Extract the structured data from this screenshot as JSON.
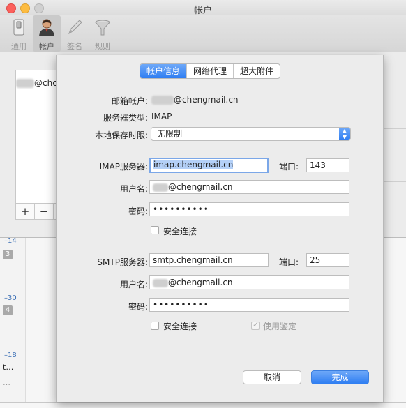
{
  "window": {
    "title": "帐户"
  },
  "toolbar": {
    "items": [
      {
        "label": "通用",
        "icon": "switch-icon",
        "active": false
      },
      {
        "label": "帐户",
        "icon": "user-icon",
        "active": true
      },
      {
        "label": "签名",
        "icon": "pen-icon",
        "active": false
      },
      {
        "label": "规则",
        "icon": "funnel-icon",
        "active": false
      }
    ]
  },
  "accounts": {
    "first_suffix": "@chc",
    "add": "+",
    "remove": "−"
  },
  "background": {
    "nums": [
      "–14",
      "–30",
      "–18"
    ],
    "badges": [
      "3",
      "4"
    ],
    "snippets": [
      "t…",
      "…"
    ]
  },
  "sheet": {
    "tabs": [
      {
        "label": "帐户信息",
        "active": true
      },
      {
        "label": "网络代理",
        "active": false
      },
      {
        "label": "超大附件",
        "active": false
      }
    ],
    "info": {
      "email_label": "邮箱帐户:",
      "email_value": "@chengmail.cn",
      "server_type_label": "服务器类型:",
      "server_type_value": "IMAP",
      "retention_label": "本地保存时限:",
      "retention_value": "无限制"
    },
    "imap": {
      "server_label": "IMAP服务器:",
      "server_value": "imap.chengmail.cn",
      "port_label": "端口:",
      "port_value": "143",
      "user_label": "用户名:",
      "user_value": "@chengmail.cn",
      "pass_label": "密码:",
      "pass_value": "••••••••••",
      "secure_label": "安全连接"
    },
    "smtp": {
      "server_label": "SMTP服务器:",
      "server_value": "smtp.chengmail.cn",
      "port_label": "端口:",
      "port_value": "25",
      "user_label": "用户名:",
      "user_value": "@chengmail.cn",
      "pass_label": "密码:",
      "pass_value": "••••••••••",
      "secure_label": "安全连接",
      "auth_label": "使用鉴定"
    },
    "buttons": {
      "cancel": "取消",
      "done": "完成"
    }
  },
  "colors": {
    "accent": "#2f7ef2",
    "close": "#fc605c",
    "minimize": "#fdbc40"
  }
}
